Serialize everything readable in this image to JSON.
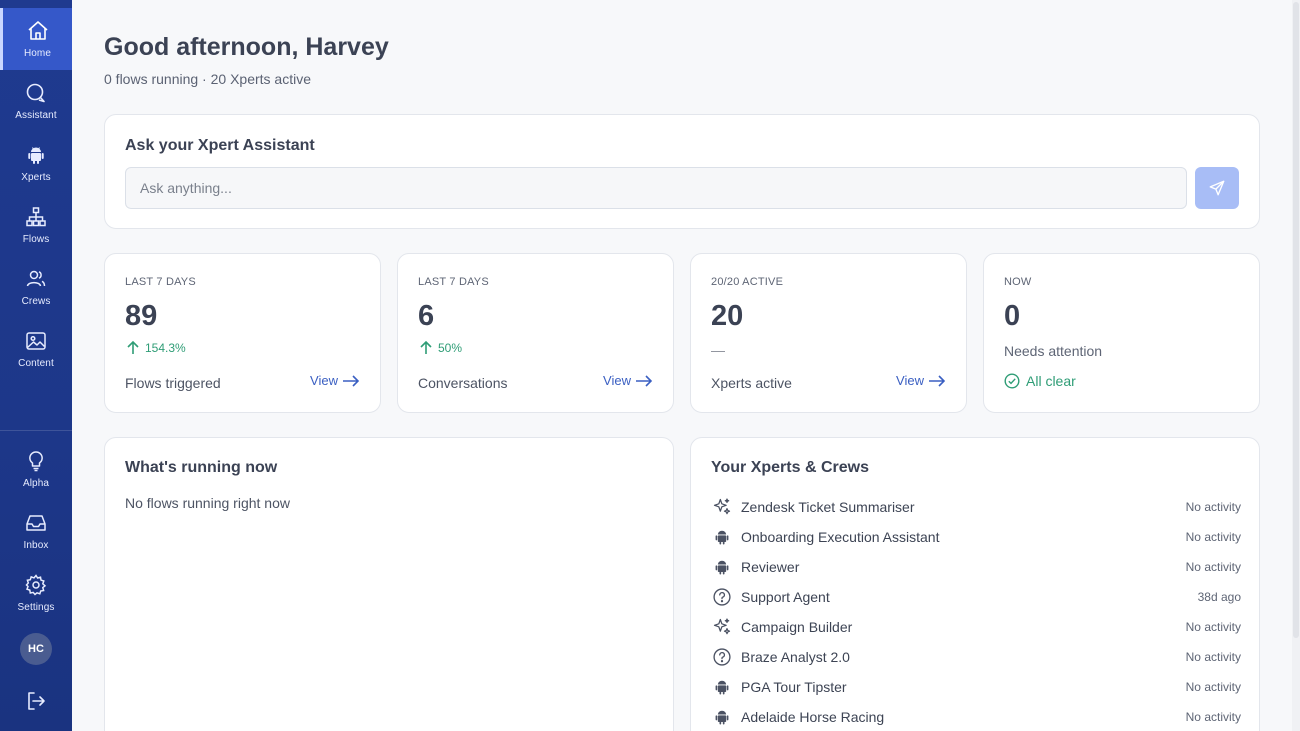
{
  "sidebar": {
    "items": [
      {
        "label": "Home",
        "icon": "home-icon",
        "active": true
      },
      {
        "label": "Assistant",
        "icon": "chat-icon"
      },
      {
        "label": "Xperts",
        "icon": "android-icon"
      },
      {
        "label": "Flows",
        "icon": "flow-icon"
      },
      {
        "label": "Crews",
        "icon": "users-icon"
      },
      {
        "label": "Content",
        "icon": "image-icon"
      }
    ],
    "bottom_items": [
      {
        "label": "Alpha",
        "icon": "lightbulb-icon"
      },
      {
        "label": "Inbox",
        "icon": "inbox-icon"
      },
      {
        "label": "Settings",
        "icon": "gear-icon"
      }
    ],
    "avatar_initials": "HC"
  },
  "header": {
    "greeting": "Good afternoon, Harvey",
    "subtitle": "0 flows running · 20 Xperts active"
  },
  "assistant": {
    "title": "Ask your Xpert Assistant",
    "placeholder": "Ask anything..."
  },
  "stats": [
    {
      "caption": "LAST 7 DAYS",
      "value": "89",
      "delta": "154.3%",
      "label": "Flows triggered",
      "link": "View"
    },
    {
      "caption": "LAST 7 DAYS",
      "value": "6",
      "delta": "50%",
      "label": "Conversations",
      "link": "View"
    },
    {
      "caption": "20/20 ACTIVE",
      "value": "20",
      "delta_placeholder": "—",
      "label": "Xperts active",
      "link": "View"
    },
    {
      "caption": "NOW",
      "value": "0",
      "sublabel": "Needs attention",
      "status": "All clear"
    }
  ],
  "running": {
    "title": "What's running now",
    "empty": "No flows running right now"
  },
  "xperts": {
    "title": "Your Xperts & Crews",
    "items": [
      {
        "name": "Zendesk Ticket Summariser",
        "icon": "sparkle-icon",
        "status": "No activity"
      },
      {
        "name": "Onboarding Execution Assistant",
        "icon": "android-icon",
        "status": "No activity"
      },
      {
        "name": "Reviewer",
        "icon": "android-icon",
        "status": "No activity"
      },
      {
        "name": "Support Agent",
        "icon": "question-circle-icon",
        "status": "38d ago"
      },
      {
        "name": "Campaign Builder",
        "icon": "sparkle-icon",
        "status": "No activity"
      },
      {
        "name": "Braze Analyst 2.0",
        "icon": "question-circle-icon",
        "status": "No activity"
      },
      {
        "name": "PGA Tour Tipster",
        "icon": "android-icon",
        "status": "No activity"
      },
      {
        "name": "Adelaide Horse Racing",
        "icon": "android-icon",
        "status": "No activity"
      }
    ]
  },
  "colors": {
    "sidebar": "#1f3a8f",
    "sidebar_active": "#3558c9",
    "accent_link": "#3a5fc2",
    "success": "#2f9d76",
    "send_button": "#a8bdf6"
  }
}
